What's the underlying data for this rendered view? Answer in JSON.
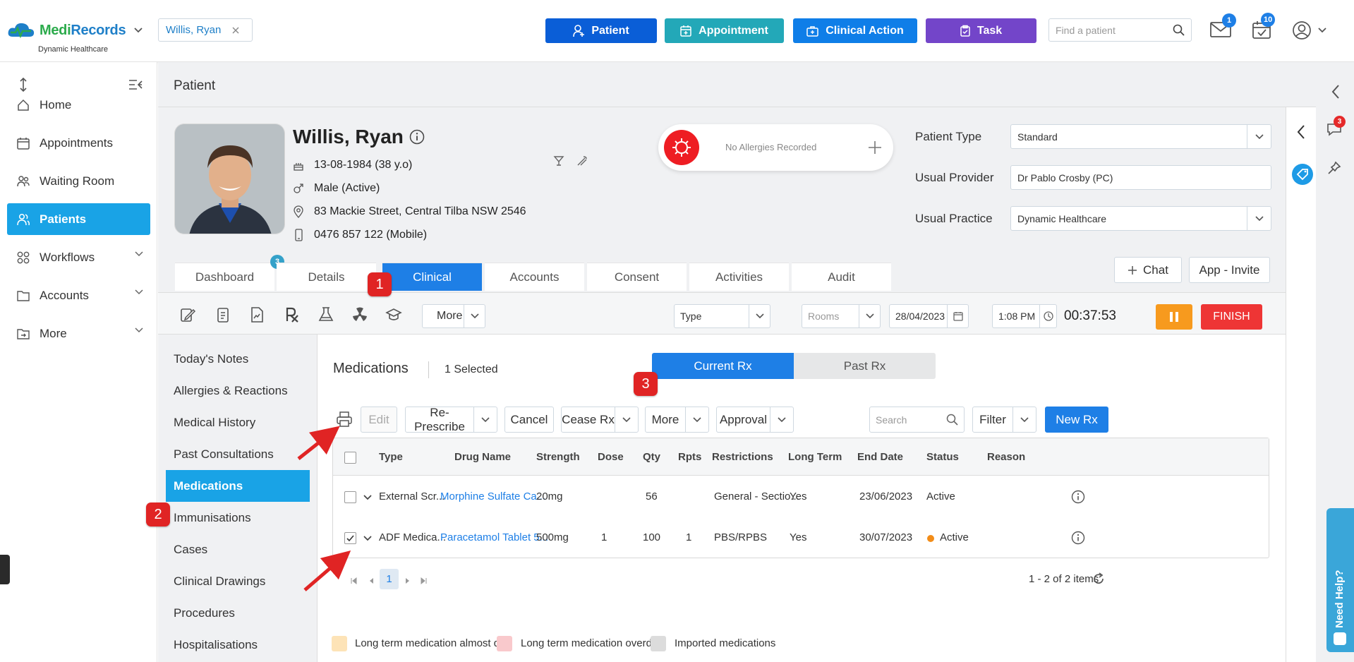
{
  "topbar": {
    "logo": {
      "medi": "Medi",
      "records": "Records",
      "subtitle": "Dynamic Healthcare"
    },
    "patient_chip": "Willis, Ryan",
    "buttons": {
      "patient": "Patient",
      "appointment": "Appointment",
      "clinical_action": "Clinical Action",
      "task": "Task"
    },
    "find_placeholder": "Find a patient",
    "mail_badge": "1",
    "tasks_badge": "10",
    "colors": {
      "patient": "#0a5ed7",
      "appointment": "#23a8b8",
      "clinical_action": "#0f7ee8",
      "task": "#7345c9"
    }
  },
  "sidebar": {
    "items": [
      {
        "label": "Home",
        "icon": "home-icon"
      },
      {
        "label": "Appointments",
        "icon": "calendar-icon"
      },
      {
        "label": "Waiting Room",
        "icon": "people-icon"
      },
      {
        "label": "Patients",
        "icon": "patients-icon",
        "active": true
      },
      {
        "label": "Workflows",
        "icon": "workflow-icon"
      },
      {
        "label": "Accounts",
        "icon": "folder-icon"
      },
      {
        "label": "More",
        "icon": "folder-out-icon"
      }
    ]
  },
  "page": {
    "title": "Patient"
  },
  "patient": {
    "name": "Willis, Ryan",
    "dob": "13-08-1984 (38 y.o)",
    "gender": "Male (Active)",
    "address": "83 Mackie Street, Central Tilba NSW 2546",
    "phone": "0476 857 122 (Mobile)",
    "allergies": "No Allergies Recorded",
    "patient_type_label": "Patient Type",
    "patient_type": "Standard",
    "usual_provider_label": "Usual Provider",
    "usual_provider": "Dr Pablo Crosby (PC)",
    "usual_practice_label": "Usual Practice",
    "usual_practice": "Dynamic Healthcare"
  },
  "tabs": [
    "Dashboard",
    "Details",
    "Clinical",
    "Accounts",
    "Consent",
    "Activities",
    "Audit"
  ],
  "dashboard_badge": "3",
  "chat_label": "Chat",
  "app_invite_label": "App - Invite",
  "toolbar": {
    "more": "More",
    "type": "Type",
    "rooms": "Rooms",
    "date": "28/04/2023",
    "time": "1:08 PM",
    "timer": "00:37:53",
    "finish": "FINISH"
  },
  "clinical_nav": [
    "Today's Notes",
    "Allergies & Reactions",
    "Medical History",
    "Past Consultations",
    "Medications",
    "Immunisations",
    "Cases",
    "Clinical Drawings",
    "Procedures",
    "Hospitalisations"
  ],
  "medications": {
    "title": "Medications",
    "selected": "1 Selected",
    "current_rx": "Current Rx",
    "past_rx": "Past Rx",
    "actions": {
      "edit": "Edit",
      "represcribe": "Re-Prescribe",
      "cancel": "Cancel",
      "cease": "Cease Rx",
      "more": "More",
      "approval": "Approval",
      "search": "Search",
      "filter": "Filter",
      "new_rx": "New Rx"
    },
    "columns": [
      "Type",
      "Drug Name",
      "Strength",
      "Dose",
      "Qty",
      "Rpts",
      "Restrictions",
      "Long Term",
      "End Date",
      "Status",
      "Reason"
    ],
    "rows": [
      {
        "type": "External Scr...",
        "drug": "Morphine Sulfate Ca...",
        "strength": "20mg",
        "dose": "",
        "qty": "56",
        "rpts": "",
        "restrictions": "General - Sectio...",
        "long_term": "Yes",
        "end_date": "23/06/2023",
        "status": "Active",
        "checked": false
      },
      {
        "type": "ADF Medica...",
        "drug": "Paracetamol Tablet 5...",
        "strength": "500mg",
        "dose": "1",
        "qty": "100",
        "rpts": "1",
        "restrictions": "PBS/RPBS",
        "long_term": "Yes",
        "end_date": "30/07/2023",
        "status": "Active",
        "checked": true
      }
    ],
    "page": "1",
    "items_summary": "1 - 2 of 2 items",
    "legend": [
      "Long term medication almost due",
      "Long term medication overdue",
      "Imported medications"
    ],
    "legend_colors": [
      "#fde3b7",
      "#f9c9cc",
      "#dcdcdc"
    ]
  },
  "annotations": [
    "1",
    "2",
    "3"
  ],
  "rail": {
    "notif_badge": "3",
    "help": "Need Help?"
  }
}
